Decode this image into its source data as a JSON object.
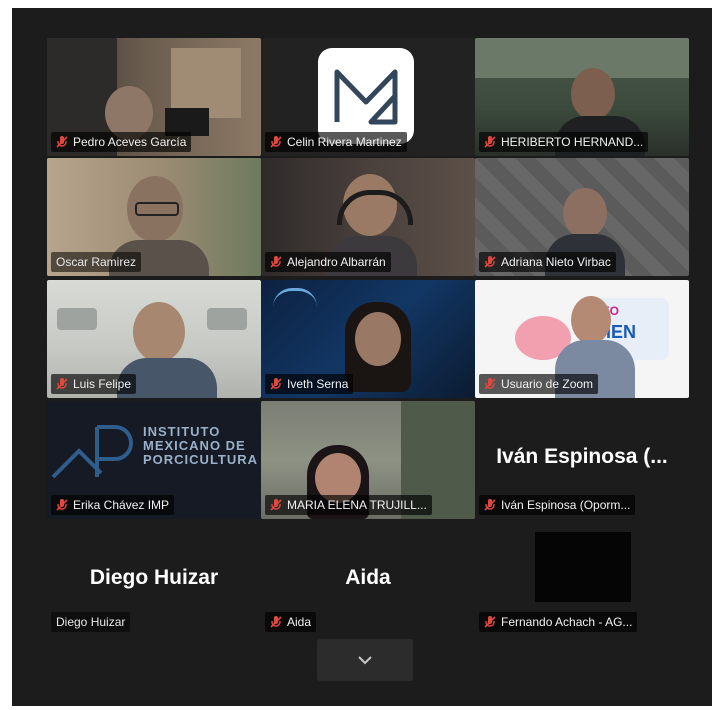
{
  "participants": [
    {
      "name": "Pedro Aceves García",
      "muted": true
    },
    {
      "name": "Celin Rivera Martinez",
      "muted": true
    },
    {
      "name": "HERIBERTO HERNAND...",
      "muted": true
    },
    {
      "name": "Oscar Ramirez",
      "muted": false,
      "speaking": true
    },
    {
      "name": "Alejandro Albarrán",
      "muted": true
    },
    {
      "name": "Adriana Nieto Virbac",
      "muted": true
    },
    {
      "name": "Luis Felipe",
      "muted": true
    },
    {
      "name": "Iveth Serna",
      "muted": true
    },
    {
      "name": "Usuario de Zoom",
      "muted": true
    },
    {
      "name": "Erika Chávez IMP",
      "muted": true
    },
    {
      "name": "MARIA ELENA TRUJILL...",
      "muted": true
    },
    {
      "name": "Iván Espinosa (Oporm...",
      "muted": true,
      "display_name": "Iván Espinosa (..."
    },
    {
      "name": "Diego Huizar",
      "muted": false,
      "display_name": "Diego Huizar"
    },
    {
      "name": "Aida",
      "muted": true,
      "display_name": "Aida"
    },
    {
      "name": "Fernando Achach - AG...",
      "muted": true
    }
  ],
  "imp_logo": {
    "line1": "INSTITUTO",
    "line2": "MEXICANO DE",
    "line3": "PORCICULTURA"
  },
  "pig_banner": {
    "line1": "DEO",
    "line2": "BIEN"
  },
  "icons": {
    "mute": "mic-muted-icon",
    "more": "chevron-down-icon"
  },
  "colors": {
    "active_speaker": "#3ad17a",
    "mute_icon": "#e0483e"
  }
}
